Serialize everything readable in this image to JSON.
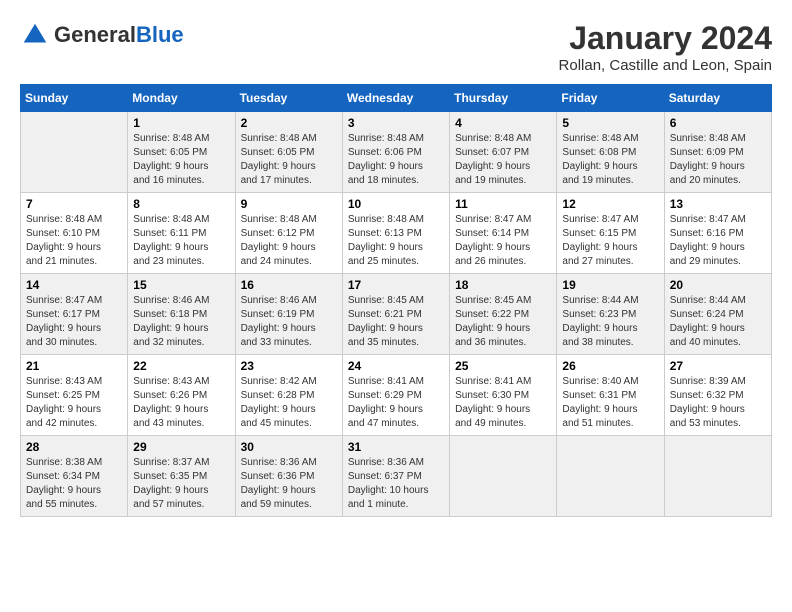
{
  "header": {
    "logo_general": "General",
    "logo_blue": "Blue",
    "month_title": "January 2024",
    "location": "Rollan, Castille and Leon, Spain"
  },
  "days_of_week": [
    "Sunday",
    "Monday",
    "Tuesday",
    "Wednesday",
    "Thursday",
    "Friday",
    "Saturday"
  ],
  "weeks": [
    [
      {
        "day": "",
        "content": ""
      },
      {
        "day": "1",
        "content": "Sunrise: 8:48 AM\nSunset: 6:05 PM\nDaylight: 9 hours\nand 16 minutes."
      },
      {
        "day": "2",
        "content": "Sunrise: 8:48 AM\nSunset: 6:05 PM\nDaylight: 9 hours\nand 17 minutes."
      },
      {
        "day": "3",
        "content": "Sunrise: 8:48 AM\nSunset: 6:06 PM\nDaylight: 9 hours\nand 18 minutes."
      },
      {
        "day": "4",
        "content": "Sunrise: 8:48 AM\nSunset: 6:07 PM\nDaylight: 9 hours\nand 19 minutes."
      },
      {
        "day": "5",
        "content": "Sunrise: 8:48 AM\nSunset: 6:08 PM\nDaylight: 9 hours\nand 19 minutes."
      },
      {
        "day": "6",
        "content": "Sunrise: 8:48 AM\nSunset: 6:09 PM\nDaylight: 9 hours\nand 20 minutes."
      }
    ],
    [
      {
        "day": "7",
        "content": "Sunrise: 8:48 AM\nSunset: 6:10 PM\nDaylight: 9 hours\nand 21 minutes."
      },
      {
        "day": "8",
        "content": "Sunrise: 8:48 AM\nSunset: 6:11 PM\nDaylight: 9 hours\nand 23 minutes."
      },
      {
        "day": "9",
        "content": "Sunrise: 8:48 AM\nSunset: 6:12 PM\nDaylight: 9 hours\nand 24 minutes."
      },
      {
        "day": "10",
        "content": "Sunrise: 8:48 AM\nSunset: 6:13 PM\nDaylight: 9 hours\nand 25 minutes."
      },
      {
        "day": "11",
        "content": "Sunrise: 8:47 AM\nSunset: 6:14 PM\nDaylight: 9 hours\nand 26 minutes."
      },
      {
        "day": "12",
        "content": "Sunrise: 8:47 AM\nSunset: 6:15 PM\nDaylight: 9 hours\nand 27 minutes."
      },
      {
        "day": "13",
        "content": "Sunrise: 8:47 AM\nSunset: 6:16 PM\nDaylight: 9 hours\nand 29 minutes."
      }
    ],
    [
      {
        "day": "14",
        "content": "Sunrise: 8:47 AM\nSunset: 6:17 PM\nDaylight: 9 hours\nand 30 minutes."
      },
      {
        "day": "15",
        "content": "Sunrise: 8:46 AM\nSunset: 6:18 PM\nDaylight: 9 hours\nand 32 minutes."
      },
      {
        "day": "16",
        "content": "Sunrise: 8:46 AM\nSunset: 6:19 PM\nDaylight: 9 hours\nand 33 minutes."
      },
      {
        "day": "17",
        "content": "Sunrise: 8:45 AM\nSunset: 6:21 PM\nDaylight: 9 hours\nand 35 minutes."
      },
      {
        "day": "18",
        "content": "Sunrise: 8:45 AM\nSunset: 6:22 PM\nDaylight: 9 hours\nand 36 minutes."
      },
      {
        "day": "19",
        "content": "Sunrise: 8:44 AM\nSunset: 6:23 PM\nDaylight: 9 hours\nand 38 minutes."
      },
      {
        "day": "20",
        "content": "Sunrise: 8:44 AM\nSunset: 6:24 PM\nDaylight: 9 hours\nand 40 minutes."
      }
    ],
    [
      {
        "day": "21",
        "content": "Sunrise: 8:43 AM\nSunset: 6:25 PM\nDaylight: 9 hours\nand 42 minutes."
      },
      {
        "day": "22",
        "content": "Sunrise: 8:43 AM\nSunset: 6:26 PM\nDaylight: 9 hours\nand 43 minutes."
      },
      {
        "day": "23",
        "content": "Sunrise: 8:42 AM\nSunset: 6:28 PM\nDaylight: 9 hours\nand 45 minutes."
      },
      {
        "day": "24",
        "content": "Sunrise: 8:41 AM\nSunset: 6:29 PM\nDaylight: 9 hours\nand 47 minutes."
      },
      {
        "day": "25",
        "content": "Sunrise: 8:41 AM\nSunset: 6:30 PM\nDaylight: 9 hours\nand 49 minutes."
      },
      {
        "day": "26",
        "content": "Sunrise: 8:40 AM\nSunset: 6:31 PM\nDaylight: 9 hours\nand 51 minutes."
      },
      {
        "day": "27",
        "content": "Sunrise: 8:39 AM\nSunset: 6:32 PM\nDaylight: 9 hours\nand 53 minutes."
      }
    ],
    [
      {
        "day": "28",
        "content": "Sunrise: 8:38 AM\nSunset: 6:34 PM\nDaylight: 9 hours\nand 55 minutes."
      },
      {
        "day": "29",
        "content": "Sunrise: 8:37 AM\nSunset: 6:35 PM\nDaylight: 9 hours\nand 57 minutes."
      },
      {
        "day": "30",
        "content": "Sunrise: 8:36 AM\nSunset: 6:36 PM\nDaylight: 9 hours\nand 59 minutes."
      },
      {
        "day": "31",
        "content": "Sunrise: 8:36 AM\nSunset: 6:37 PM\nDaylight: 10 hours\nand 1 minute."
      },
      {
        "day": "",
        "content": ""
      },
      {
        "day": "",
        "content": ""
      },
      {
        "day": "",
        "content": ""
      }
    ]
  ]
}
